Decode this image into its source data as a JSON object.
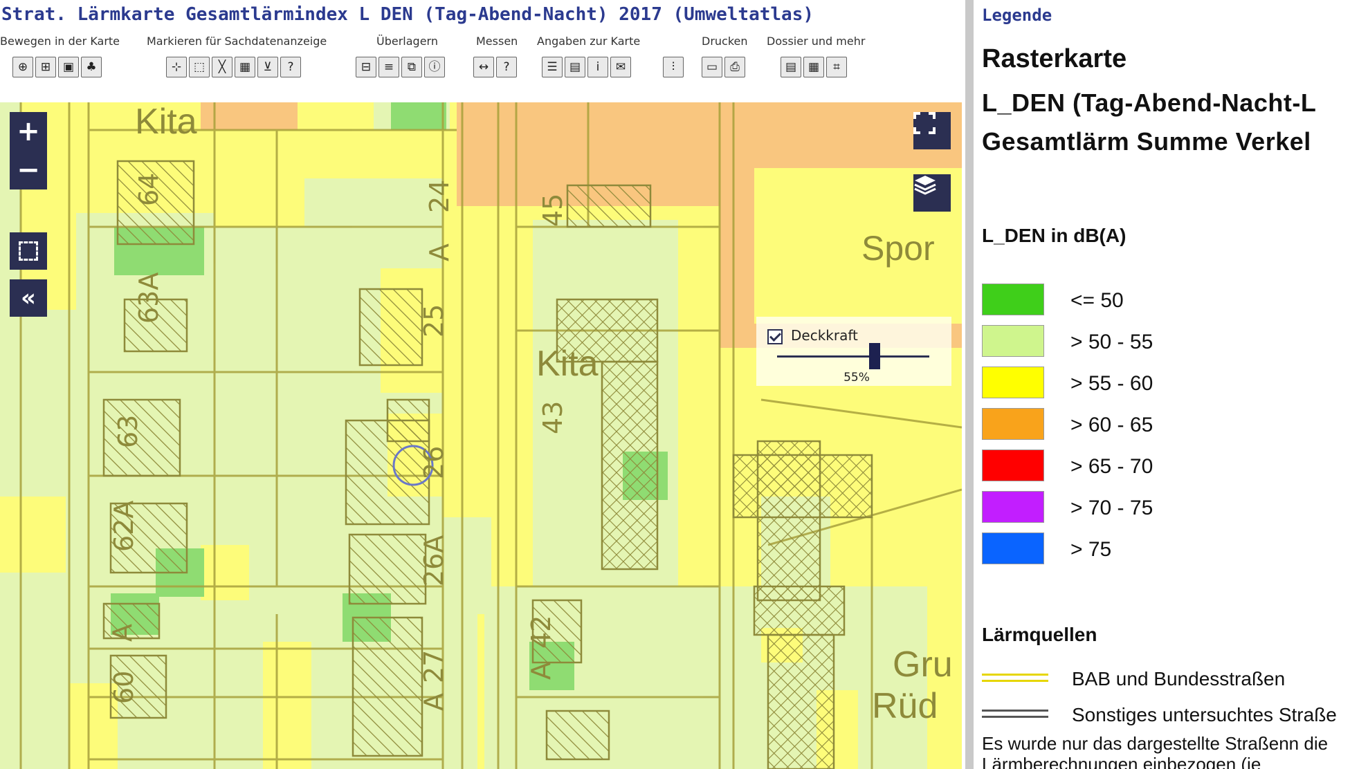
{
  "title": "Strat. Lärmkarte Gesamtlärmindex L DEN (Tag-Abend-Nacht) 2017 (Umweltatlas)",
  "toolbar": {
    "groups": [
      {
        "label": "Bewegen in der Karte",
        "icons": [
          "zoom-in-icon",
          "zoom-box-icon",
          "overview-icon",
          "tree-icon"
        ]
      },
      {
        "label": "Markieren für Sachdatenanzeige",
        "icons": [
          "select-point-icon",
          "select-box-icon",
          "select-line-icon",
          "table-icon",
          "filter-icon",
          "query-icon"
        ]
      },
      {
        "label": "Überlagern",
        "icons": [
          "overlay-map-icon",
          "list-icon",
          "layers-icon",
          "info-icon"
        ]
      },
      {
        "label": "Messen",
        "icons": [
          "measure-icon",
          "help-icon"
        ]
      },
      {
        "label": "Angaben zur Karte",
        "icons": [
          "legend-icon",
          "metadata-icon",
          "info-i-icon",
          "mail-icon"
        ]
      },
      {
        "label": "",
        "icons": [
          "settings-sliders-icon"
        ]
      },
      {
        "label": "Drucken",
        "icons": [
          "pdf-icon",
          "print-icon"
        ]
      },
      {
        "label": "Dossier und mehr",
        "icons": [
          "dossier-icon",
          "report-icon",
          "url-icon"
        ]
      }
    ]
  },
  "map": {
    "controls": {
      "zoom_in": "+",
      "zoom_out": "−",
      "fullscreen_icon": "fullscreen-icon",
      "layers_icon": "layers-icon",
      "collapse": "«"
    },
    "opacity": {
      "label": "Deckkraft",
      "value": "55%",
      "fraction": 0.55
    },
    "labels": {
      "kita_top": "Kita",
      "kita_mid": "Kita",
      "sport": "Spor",
      "gru": "Gru",
      "rud": "Rüd",
      "n64": "64",
      "n63a": "63A",
      "n63": "63",
      "n62a": "62A",
      "n60": "60",
      "n24": "24",
      "n25": "25",
      "n26": "26",
      "n26a": "26A",
      "n27": "27",
      "n45": "45",
      "n43": "43",
      "n42": "42",
      "nA24": "A",
      "nA27": "A",
      "nA61": "A",
      "nA42": "A"
    }
  },
  "legend": {
    "header": "Legende",
    "type": "Rasterkarte",
    "title_line1": "L_DEN (Tag-Abend-Nacht-L",
    "title_line2": "Gesamtlärm Summe Verkel",
    "subtitle": "L_DEN in dB(A)",
    "items": [
      {
        "label": "<= 50",
        "color": "#3fcf1a"
      },
      {
        "label": "> 50 - 55",
        "color": "#cff58d"
      },
      {
        "label": "> 55 - 60",
        "color": "#ffff00"
      },
      {
        "label": "> 60 - 65",
        "color": "#f9a31b"
      },
      {
        "label": "> 65 - 70",
        "color": "#ff0000"
      },
      {
        "label": "> 70 - 75",
        "color": "#c21eff"
      },
      {
        "label": "> 75",
        "color": "#0a64ff"
      }
    ],
    "sources_title": "Lärmquellen",
    "sources": [
      {
        "label": "BAB und Bundesstraßen",
        "color": "#e6d600"
      },
      {
        "label": "Sonstiges untersuchtes Straße",
        "color": "#555555"
      }
    ],
    "note": "Es wurde nur das dargestellte Straßenn die Lärmberechnungen einbezogen (je"
  }
}
